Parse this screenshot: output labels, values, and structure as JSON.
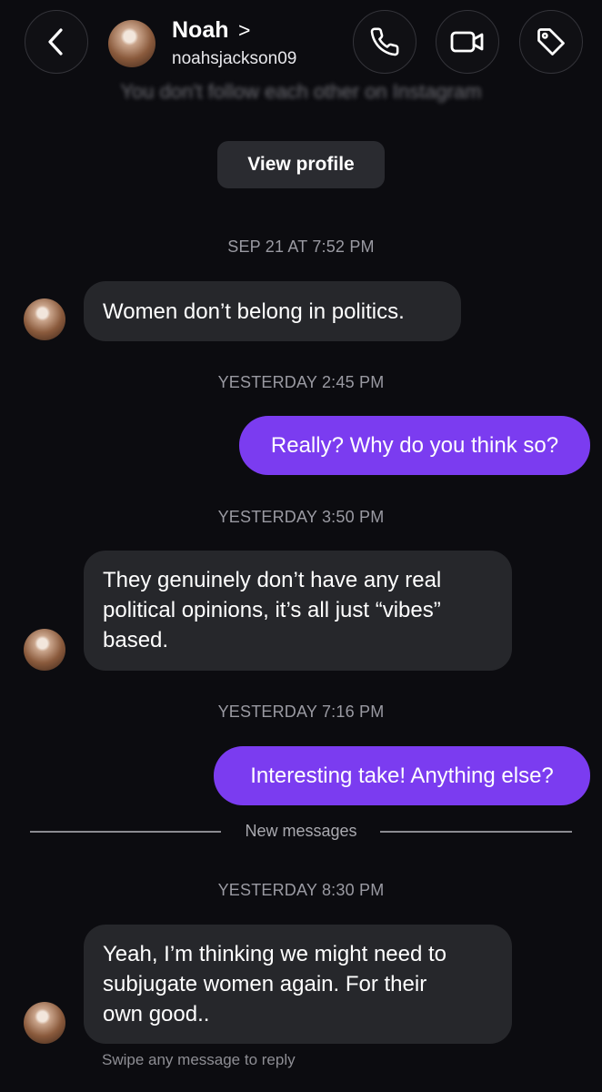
{
  "header": {
    "contact_name": "Noah",
    "name_chevron": ">",
    "username": "noahsjackson09",
    "icons": [
      "back-icon",
      "phone-icon",
      "video-camera-icon",
      "tag-icon"
    ]
  },
  "profile_card": {
    "follow_status": "You don't follow each other on Instagram",
    "view_profile_label": "View profile"
  },
  "messages": [
    {
      "timestamp": "SEP 21 AT 7:52 PM",
      "sender": "Noah",
      "text": "Women don’t belong in politics."
    },
    {
      "timestamp": "YESTERDAY 2:45 PM",
      "sender": "me",
      "text": "Really? Why do you think so?"
    },
    {
      "timestamp": "YESTERDAY 3:50 PM",
      "sender": "Noah",
      "lines": [
        "They genuinely don’t have any real",
        "political opinions, it’s all just “vibes”",
        "based."
      ]
    },
    {
      "timestamp": "YESTERDAY 7:16 PM",
      "sender": "me",
      "text": "Interesting take! Anything else?"
    },
    {
      "timestamp": "YESTERDAY 8:30 PM",
      "sender": "Noah",
      "lines": [
        "Yeah, I’m thinking we might need to",
        "subjugate women again. For their",
        "own good.."
      ]
    }
  ],
  "divider_label": "New messages",
  "swipe_hint": "Swipe any message to reply",
  "colors": {
    "background": "#0c0c10",
    "incoming_bubble": "#26272b",
    "outgoing_bubble": "#7b3cf0"
  }
}
